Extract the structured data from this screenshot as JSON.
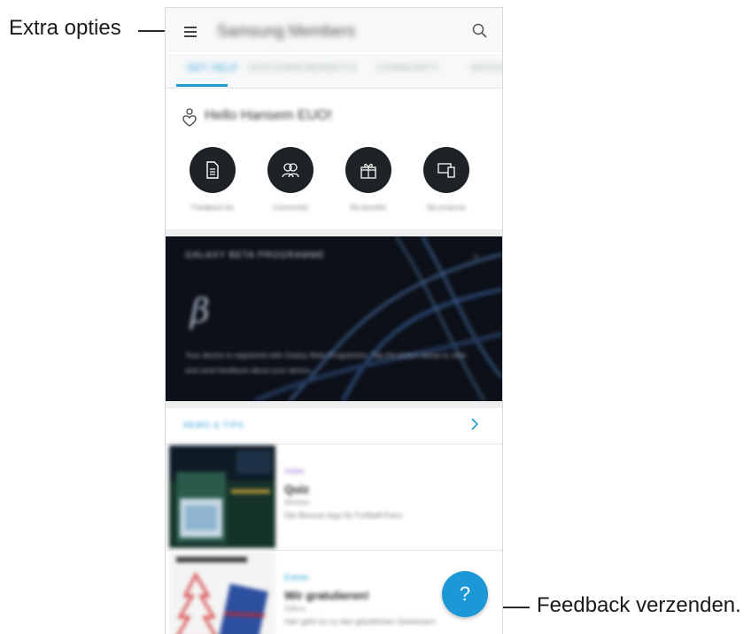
{
  "callouts": {
    "menu": "Extra opties",
    "feedback": "Feedback verzenden."
  },
  "app": {
    "title": "Samsung Members"
  },
  "tabs": [
    {
      "label": "GET HELP"
    },
    {
      "label": "DISCOVER"
    },
    {
      "label": "BENEFITS"
    },
    {
      "label": "COMMUNITY"
    },
    {
      "label": "NOTICES"
    }
  ],
  "greeting": {
    "text": "Hello Hansem EUO!"
  },
  "quick_actions": [
    {
      "label": "Feedback list",
      "icon": "document-icon"
    },
    {
      "label": "Community",
      "icon": "people-icon"
    },
    {
      "label": "My benefits",
      "icon": "gift-icon"
    },
    {
      "label": "My products",
      "icon": "devices-icon"
    }
  ],
  "banner": {
    "title": "GALAXY BETA PROGRAMME",
    "logo": "β",
    "body": "Your device is registered with Galaxy Beta Programme. Tap the button below to view and send feedback about your device."
  },
  "news": {
    "title": "NEWS & TIPS"
  },
  "articles": [
    {
      "category": "Video",
      "title": "Quiz",
      "meta": "Member",
      "desc": "Die Bonuso App für Fußball-Fans",
      "category_color": "#9b6bd1"
    },
    {
      "category": "Events",
      "title": "Wir gratulieren!",
      "meta": "Adkins",
      "desc": "Hier geht es zu den glücklichen Gewinnern",
      "category_color": "#1e9bd7"
    }
  ],
  "fab": {
    "label": "?"
  },
  "colors": {
    "accent": "#1e9bd7",
    "quick_circle": "#1f2326"
  }
}
